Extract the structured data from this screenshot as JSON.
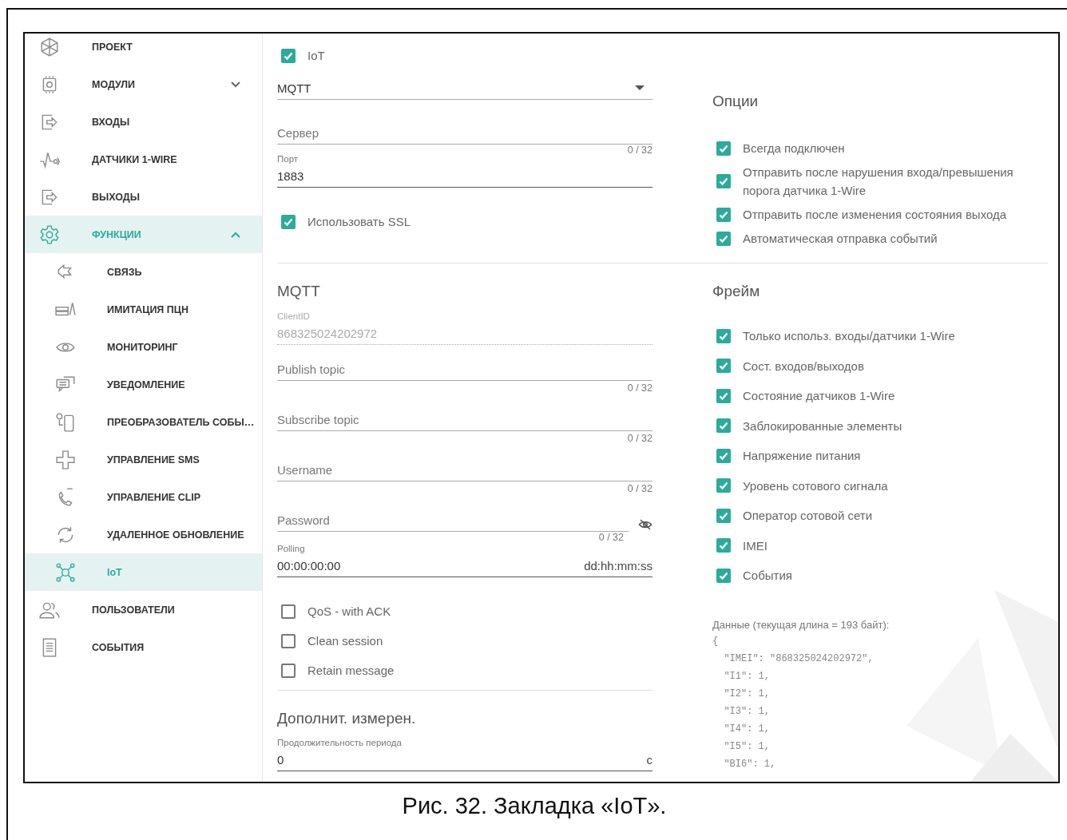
{
  "sidebar": {
    "items": [
      {
        "label": "ПРОЕКТ",
        "selected": false
      },
      {
        "label": "МОДУЛИ",
        "selected": false,
        "expanded": false
      },
      {
        "label": "ВХОДЫ",
        "selected": false
      },
      {
        "label": "ДАТЧИКИ 1-WIRE",
        "selected": false
      },
      {
        "label": "ВЫХОДЫ",
        "selected": false
      },
      {
        "label": "ФУНКЦИИ",
        "selected": true,
        "expanded": true,
        "children": [
          {
            "label": "СВЯЗЬ",
            "selected": false
          },
          {
            "label": "ИМИТАЦИЯ ПЦН",
            "selected": false
          },
          {
            "label": "МОНИТОРИНГ",
            "selected": false
          },
          {
            "label": "УВЕДОМЛЕНИЕ",
            "selected": false
          },
          {
            "label": "ПРЕОБРАЗОВАТЕЛЬ СОБЫ…",
            "selected": false
          },
          {
            "label": "УПРАВЛЕНИЕ SMS",
            "selected": false
          },
          {
            "label": "УПРАВЛЕНИЕ CLIP",
            "selected": false
          },
          {
            "label": "УДАЛЕННОЕ ОБНОВЛЕНИЕ",
            "selected": false
          },
          {
            "label": "IoT",
            "selected": true
          }
        ]
      },
      {
        "label": "ПОЛЬЗОВАТЕЛИ",
        "selected": false
      },
      {
        "label": "СОБЫТИЯ",
        "selected": false
      }
    ]
  },
  "iot_toggle": {
    "label": "IoT",
    "checked": true
  },
  "protocol_select": {
    "value": "MQTT"
  },
  "server_field": {
    "placeholder": "Сервер",
    "counter": "0 / 32"
  },
  "port_field": {
    "label": "Порт",
    "value": "1883"
  },
  "ssl_checkbox": {
    "label": "Использовать SSL",
    "checked": true
  },
  "options": {
    "title": "Опции",
    "items": [
      {
        "label": "Всегда подключен",
        "checked": true
      },
      {
        "label": "Отправить после нарушения входа/превышения порога датчика 1-Wire",
        "checked": true
      },
      {
        "label": "Отправить после изменения состояния выхода",
        "checked": true
      },
      {
        "label": "Автоматическая отправка событий",
        "checked": true
      }
    ]
  },
  "mqtt": {
    "title": "MQTT",
    "client_id": {
      "label": "ClientID",
      "value": "868325024202972"
    },
    "fields": [
      {
        "kind": "text",
        "placeholder": "Publish topic",
        "counter": "0 / 32"
      },
      {
        "kind": "text",
        "placeholder": "Subscribe topic",
        "counter": "0 / 32"
      },
      {
        "kind": "text",
        "placeholder": "Username",
        "counter": "0 / 32"
      },
      {
        "kind": "password",
        "placeholder": "Password",
        "counter": "0 / 32"
      }
    ],
    "polling": {
      "label": "Polling",
      "value": "00:00:00:00",
      "suffix": "dd:hh:mm:ss"
    },
    "flags": [
      {
        "label": "QoS - with ACK",
        "checked": false
      },
      {
        "label": "Clean session",
        "checked": false
      },
      {
        "label": "Retain message",
        "checked": false
      }
    ]
  },
  "extra": {
    "title": "Дополнит. измерен.",
    "field": {
      "label": "Продолжительность периода",
      "value": "0",
      "suffix": "с"
    }
  },
  "frame": {
    "title": "Фрейм",
    "items": [
      {
        "label": "Только использ. входы/датчики 1-Wire",
        "checked": true
      },
      {
        "label": "Сост. входов/выходов",
        "checked": true
      },
      {
        "label": "Состояние датчиков 1-Wire",
        "checked": true
      },
      {
        "label": "Заблокированные элементы",
        "checked": true
      },
      {
        "label": "Напряжение питания",
        "checked": true
      },
      {
        "label": "Уровень сотового сигнала",
        "checked": true
      },
      {
        "label": "Оператор сотовой сети",
        "checked": true
      },
      {
        "label": "IMEI",
        "checked": true
      },
      {
        "label": "События",
        "checked": true
      }
    ]
  },
  "data": {
    "label": "Данные (текущая длина = 193 байт):",
    "lines": [
      "{",
      "  \"IMEI\": \"868325024202972\",",
      "  \"I1\": 1,",
      "  \"I2\": 1,",
      "  \"I3\": 1,",
      "  \"I4\": 1,",
      "  \"I5\": 1,",
      "  \"BI6\": 1,"
    ]
  },
  "caption": "Рис. 32. Закладка «IoT»."
}
